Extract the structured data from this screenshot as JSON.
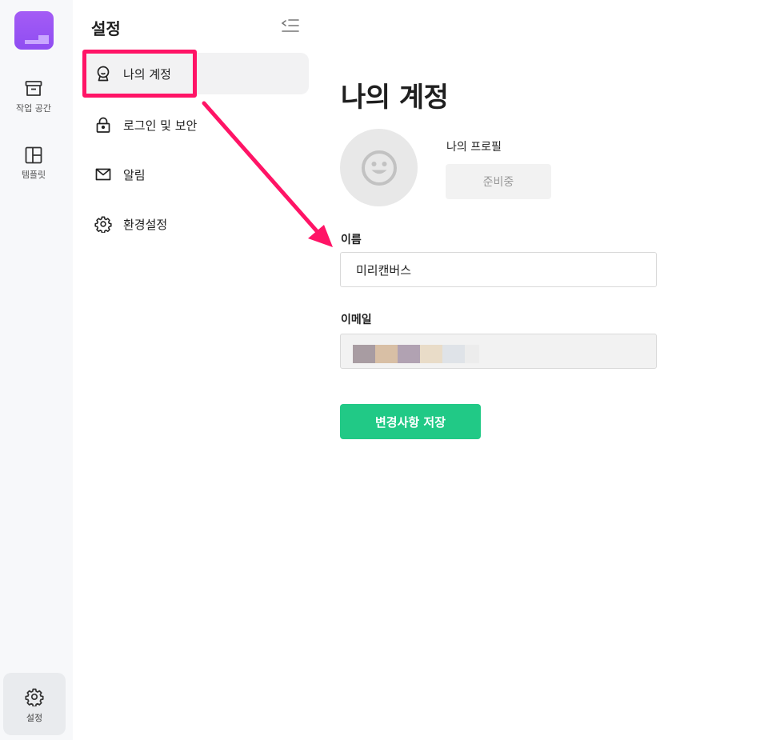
{
  "rail": {
    "workspace_label": "작업 공간",
    "templates_label": "템플릿",
    "settings_label": "설정"
  },
  "settings_nav": {
    "title": "설정",
    "items": [
      {
        "label": "나의 계정",
        "icon": "account-icon"
      },
      {
        "label": "로그인 및 보안",
        "icon": "lock-icon"
      },
      {
        "label": "알림",
        "icon": "mail-icon"
      },
      {
        "label": "환경설정",
        "icon": "gear-icon"
      }
    ]
  },
  "main": {
    "title": "나의 계정",
    "profile_label": "나의 프로필",
    "profile_button": "준비중",
    "name_label": "이름",
    "name_value": "미리캔버스",
    "email_label": "이메일",
    "save_button": "변경사항 저장"
  },
  "colors": {
    "brand": "#9b55f4",
    "accent_green": "#21c986",
    "annotation": "#ff1466"
  }
}
